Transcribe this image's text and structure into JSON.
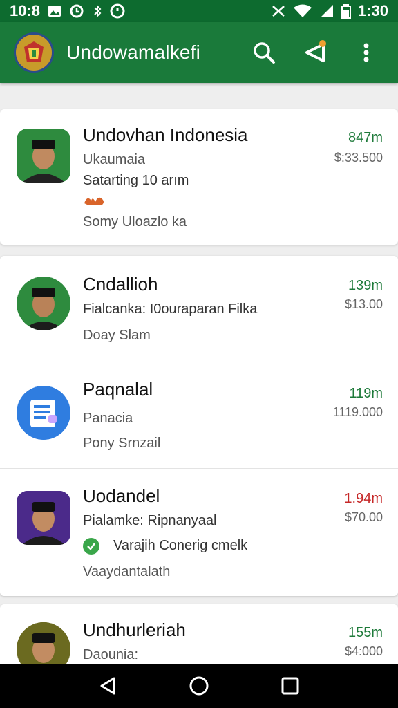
{
  "status_bar": {
    "left_time": "10:8",
    "time": "1:30"
  },
  "app_bar": {
    "title": "Undowamalkefi"
  },
  "items": [
    {
      "title": "Undovhan Indonesia",
      "line1": "Ukaumaia",
      "line2": "Satarting 10 arım",
      "line3": "Somy Uloazlo ka",
      "price": "847m",
      "price_sub": "$:33.500",
      "avatar_color": "#2e8b3e"
    },
    {
      "title": "Cndallioh",
      "line1": "Fialcanka: I0ouraparan Filka",
      "line2": "Doay Slam",
      "price": "139m",
      "price_sub": "$13.00",
      "avatar_color": "#2e8b3e"
    },
    {
      "title": "Paqnalal",
      "line1": "Panacia",
      "line2": "Pony Srnzail",
      "price": "119m",
      "price_sub": "1119.000",
      "avatar_color": "#2f7de0"
    },
    {
      "title": "Uodandel",
      "line1": "Pialamke: Ripnanyaal",
      "line2": "Varajih Conerig cmelk",
      "line3": "Vaaydantalath",
      "price": "1.94m",
      "price_sub": "$70.00",
      "avatar_color": "#4b2a8a"
    },
    {
      "title": "Undhurleriah",
      "line1": "Daounia:",
      "price": "155m",
      "price_sub": "$4:000",
      "avatar_color": "#6b6a20"
    }
  ],
  "colors": {
    "status_bar": "#0d6b2f",
    "app_bar": "#1a7a3a",
    "price_green": "#1e7a3a",
    "price_red": "#c62828"
  },
  "icons": {
    "search": "search-icon",
    "share": "share-icon",
    "more": "more-vert-icon",
    "back": "back-icon",
    "home": "home-icon",
    "recents": "recents-icon"
  }
}
